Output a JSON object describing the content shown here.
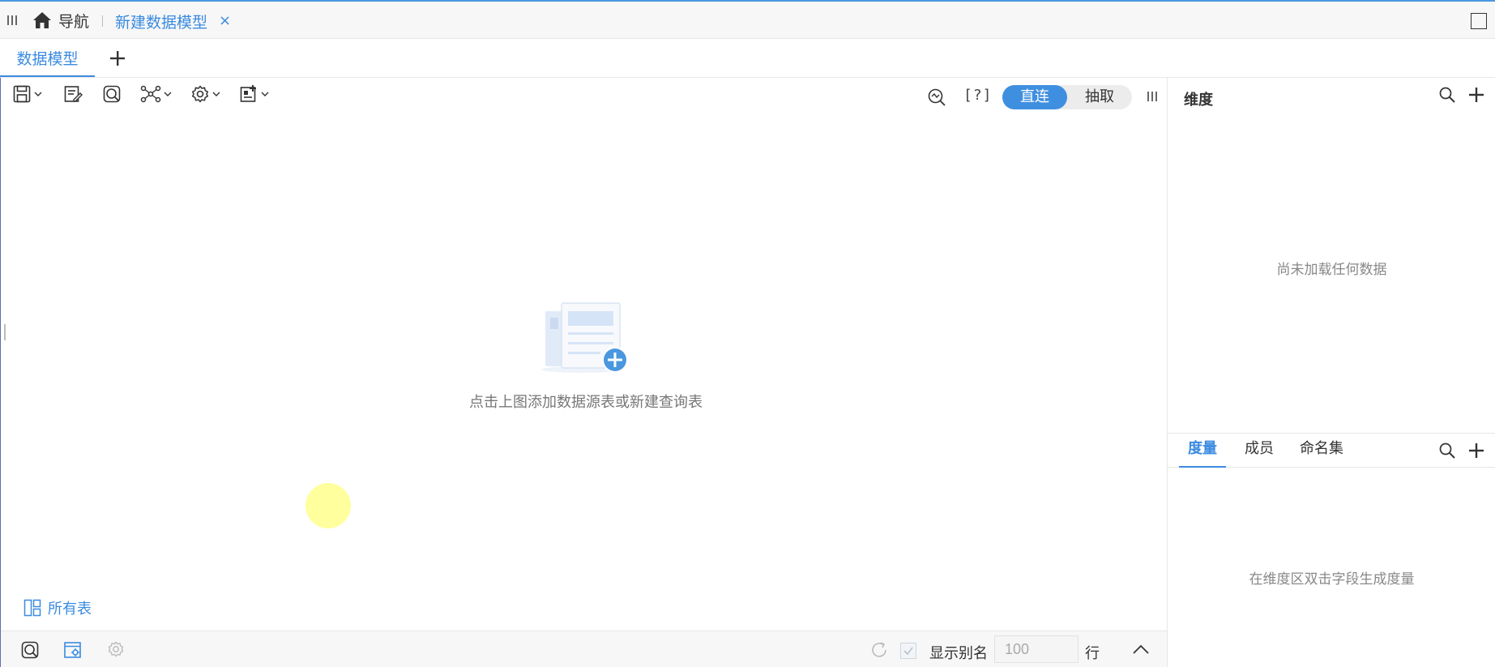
{
  "nav": {
    "home_label": "导航",
    "open_tab_label": "新建数据模型",
    "close_label": "×"
  },
  "subtabs": {
    "active_label": "数据模型"
  },
  "toolbar": {
    "help_label": "[?]",
    "mode_direct": "直连",
    "mode_extract": "抽取",
    "active_mode": "直连"
  },
  "canvas": {
    "empty_message": "点击上图添加数据源表或新建查询表",
    "all_tables_label": "所有表"
  },
  "bottom": {
    "show_alias_label": "显示别名",
    "show_alias_checked": true,
    "rows_value": "100",
    "rows_unit": "行"
  },
  "right": {
    "dimension_title": "维度",
    "dimension_empty": "尚未加载任何数据",
    "tabs": [
      {
        "label": "度量",
        "active": true
      },
      {
        "label": "成员",
        "active": false
      },
      {
        "label": "命名集",
        "active": false
      }
    ],
    "measure_empty": "在维度区双击字段生成度量"
  },
  "colors": {
    "accent": "#3b8be0",
    "frame_top": "#4a97e0",
    "muted_text": "#888888"
  }
}
